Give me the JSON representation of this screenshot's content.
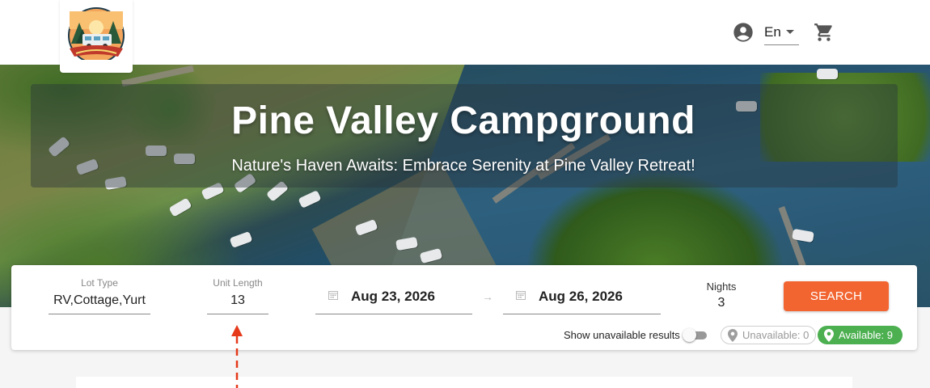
{
  "header": {
    "logo_icon": "campground-rv-logo",
    "language": "En",
    "icons": [
      "account-circle-icon",
      "chevron-down-icon",
      "shopping-cart-icon"
    ]
  },
  "hero": {
    "title": "Pine Valley Campground",
    "subtitle": "Nature's Haven Awaits: Embrace Serenity at Pine Valley Retreat!"
  },
  "search": {
    "lot_type": {
      "label": "Lot Type",
      "value": "RV,Cottage,Yurt"
    },
    "unit_length": {
      "label": "Unit Length",
      "value": "13"
    },
    "checkin": "Aug 23, 2026",
    "checkout": "Aug 26, 2026",
    "nights": {
      "label": "Nights",
      "value": "3"
    },
    "search_button": "SEARCH",
    "show_unavailable_label": "Show unavailable results",
    "show_unavailable_on": false,
    "unavailable_chip": "Unavailable: 0",
    "available_chip": "Available: 9"
  },
  "colors": {
    "accent": "#f26531",
    "available_green": "#4caf50",
    "annotation_red": "#e5391a"
  }
}
